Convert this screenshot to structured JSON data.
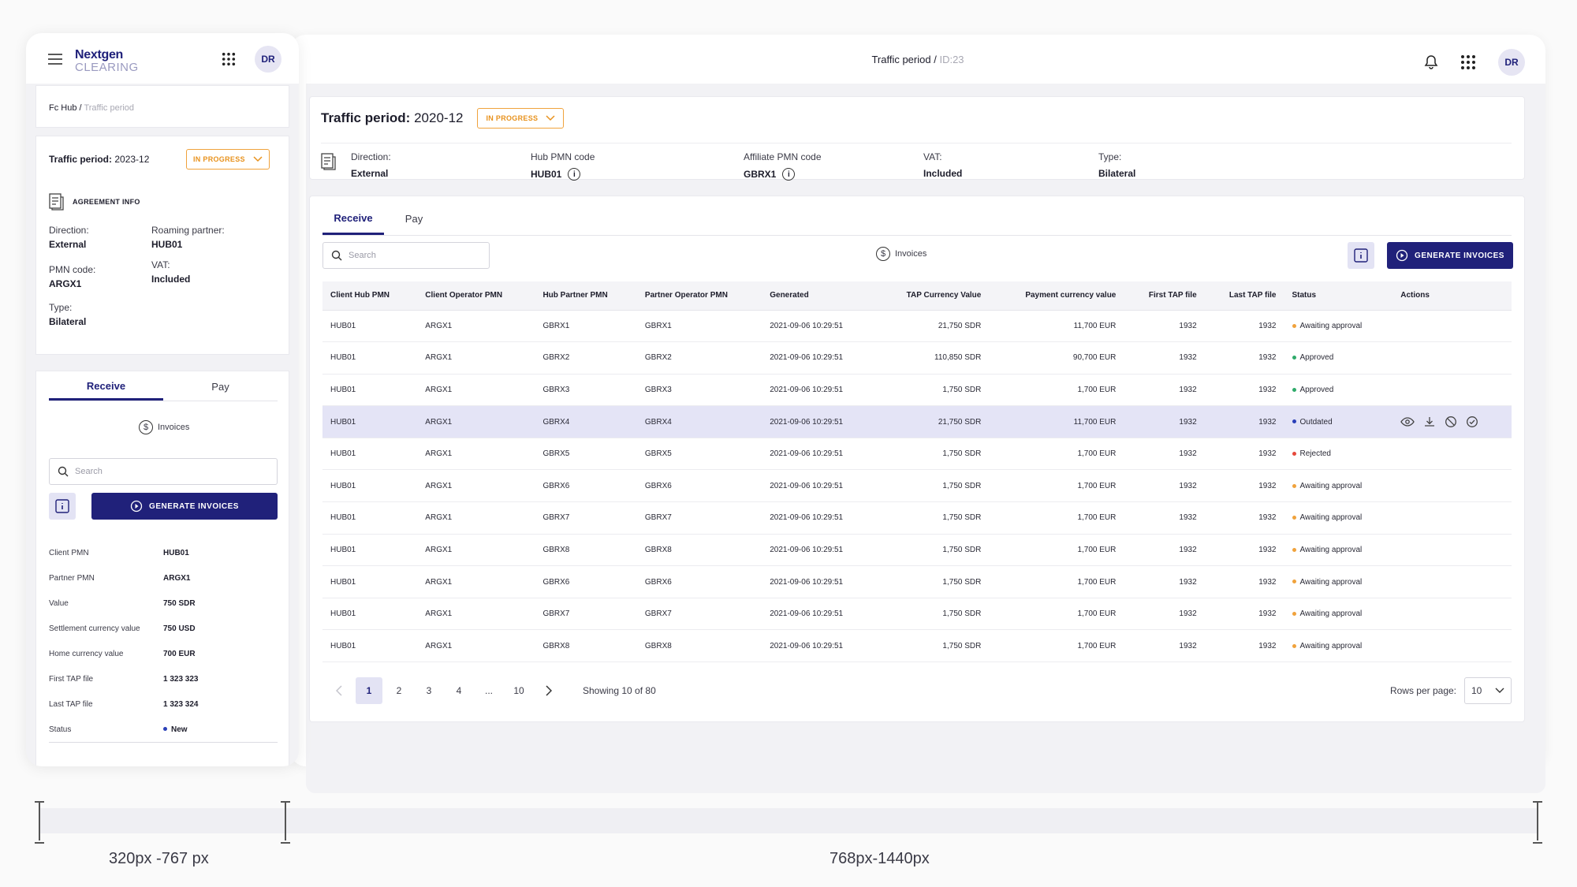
{
  "desktop": {
    "breadcrumb": {
      "current": "Traffic period",
      "sep": "/",
      "id": "ID:23"
    },
    "avatar": "DR",
    "traffic_period": {
      "label": "Traffic period:",
      "value": "2020-12",
      "status": "IN PROGRESS"
    },
    "meta": [
      {
        "label": "Direction:",
        "value": "External",
        "info": false
      },
      {
        "label": "Hub PMN code",
        "value": "HUB01",
        "info": true
      },
      {
        "label": "Affiliate PMN code",
        "value": "GBRX1",
        "info": true
      },
      {
        "label": "VAT:",
        "value": "Included",
        "info": false
      },
      {
        "label": "Type:",
        "value": "Bilateral",
        "info": false
      }
    ],
    "tabs": [
      "Receive",
      "Pay"
    ],
    "search_placeholder": "Search",
    "invoices_label": "Invoices",
    "generate_label": "GENERATE INVOICES",
    "table": {
      "headers": [
        "Client Hub PMN",
        "Client Operator PMN",
        "Hub Partner PMN",
        "Partner Operator PMN",
        "Generated",
        "TAP Currency Value",
        "Payment currency value",
        "First TAP file",
        "Last TAP file",
        "Status",
        "Actions"
      ],
      "rows": [
        [
          "HUB01",
          "ARGX1",
          "GBRX1",
          "GBRX1",
          "2021-09-06 10:29:51",
          "21,750 SDR",
          "11,700 EUR",
          "1932",
          "1932",
          "Awaiting approval"
        ],
        [
          "HUB01",
          "ARGX1",
          "GBRX2",
          "GBRX2",
          "2021-09-06 10:29:51",
          "110,850 SDR",
          "90,700 EUR",
          "1932",
          "1932",
          "Approved"
        ],
        [
          "HUB01",
          "ARGX1",
          "GBRX3",
          "GBRX3",
          "2021-09-06 10:29:51",
          "1,750 SDR",
          "1,700 EUR",
          "1932",
          "1932",
          "Approved"
        ],
        [
          "HUB01",
          "ARGX1",
          "GBRX4",
          "GBRX4",
          "2021-09-06 10:29:51",
          "21,750 SDR",
          "11,700 EUR",
          "1932",
          "1932",
          "Outdated"
        ],
        [
          "HUB01",
          "ARGX1",
          "GBRX5",
          "GBRX5",
          "2021-09-06 10:29:51",
          "1,750 SDR",
          "1,700 EUR",
          "1932",
          "1932",
          "Rejected"
        ],
        [
          "HUB01",
          "ARGX1",
          "GBRX6",
          "GBRX6",
          "2021-09-06 10:29:51",
          "1,750 SDR",
          "1,700 EUR",
          "1932",
          "1932",
          "Awaiting approval"
        ],
        [
          "HUB01",
          "ARGX1",
          "GBRX7",
          "GBRX7",
          "2021-09-06 10:29:51",
          "1,750 SDR",
          "1,700 EUR",
          "1932",
          "1932",
          "Awaiting approval"
        ],
        [
          "HUB01",
          "ARGX1",
          "GBRX8",
          "GBRX8",
          "2021-09-06 10:29:51",
          "1,750 SDR",
          "1,700 EUR",
          "1932",
          "1932",
          "Awaiting approval"
        ],
        [
          "HUB01",
          "ARGX1",
          "GBRX6",
          "GBRX6",
          "2021-09-06 10:29:51",
          "1,750 SDR",
          "1,700 EUR",
          "1932",
          "1932",
          "Awaiting approval"
        ],
        [
          "HUB01",
          "ARGX1",
          "GBRX7",
          "GBRX7",
          "2021-09-06 10:29:51",
          "1,750 SDR",
          "1,700 EUR",
          "1932",
          "1932",
          "Awaiting approval"
        ],
        [
          "HUB01",
          "ARGX1",
          "GBRX8",
          "GBRX8",
          "2021-09-06 10:29:51",
          "1,750 SDR",
          "1,700 EUR",
          "1932",
          "1932",
          "Awaiting approval"
        ]
      ],
      "selected_row": 3,
      "row_actions": [
        "eye-icon",
        "download-icon",
        "reject-icon",
        "approve-icon"
      ]
    },
    "pagination": {
      "pages": [
        "1",
        "2",
        "3",
        "4",
        "...",
        "10"
      ],
      "active": "1",
      "showing": "Showing 10 of 80"
    },
    "rows_per_page": {
      "label": "Rows per page:",
      "value": "10"
    }
  },
  "status_colors": {
    "Awaiting approval": "#f0a23c",
    "Approved": "#2faa6a",
    "Outdated": "#2a3fb8",
    "Rejected": "#e5483b",
    "New": "#2a3fb8"
  },
  "colors": {
    "primary": "#20217a",
    "accent_light": "#e3e3f4",
    "warning": "#f0a23c"
  },
  "mobile": {
    "logo": {
      "line1": "Nextgen",
      "line2": "CLEARING"
    },
    "avatar": "DR",
    "breadcrumb": {
      "root": "Fc Hub",
      "sep": "/",
      "current": "Traffic period"
    },
    "traffic_period": {
      "label": "Traffic period:",
      "value": "2023-12",
      "status": "IN PROGRESS"
    },
    "agreement_title": "AGREEMENT INFO",
    "agreement": {
      "direction": {
        "label": "Direction:",
        "value": "External"
      },
      "roaming": {
        "label": "Roaming partner:",
        "value": "HUB01"
      },
      "pmn": {
        "label": "PMN code:",
        "value": "ARGX1"
      },
      "vat": {
        "label": "VAT:",
        "value": "Included"
      },
      "type": {
        "label": "Type:",
        "value": "Bilateral"
      }
    },
    "tabs": [
      "Receive",
      "Pay"
    ],
    "invoices_label": "Invoices",
    "search_placeholder": "Search",
    "generate_label": "GENERATE INVOICES",
    "details": [
      {
        "label": "Client PMN",
        "value": "HUB01"
      },
      {
        "label": "Partner PMN",
        "value": "ARGX1"
      },
      {
        "label": "Value",
        "value": "750 SDR"
      },
      {
        "label": "Settlement currency value",
        "value": "750 USD"
      },
      {
        "label": "Home currency value",
        "value": "700 EUR"
      },
      {
        "label": "First TAP file",
        "value": "1 323 323"
      },
      {
        "label": "Last TAP file",
        "value": "1 323 324"
      },
      {
        "label": "Status",
        "value": "New"
      }
    ]
  },
  "breakpoints": {
    "mobile": "320px -767 px",
    "desktop": "768px-1440px"
  }
}
